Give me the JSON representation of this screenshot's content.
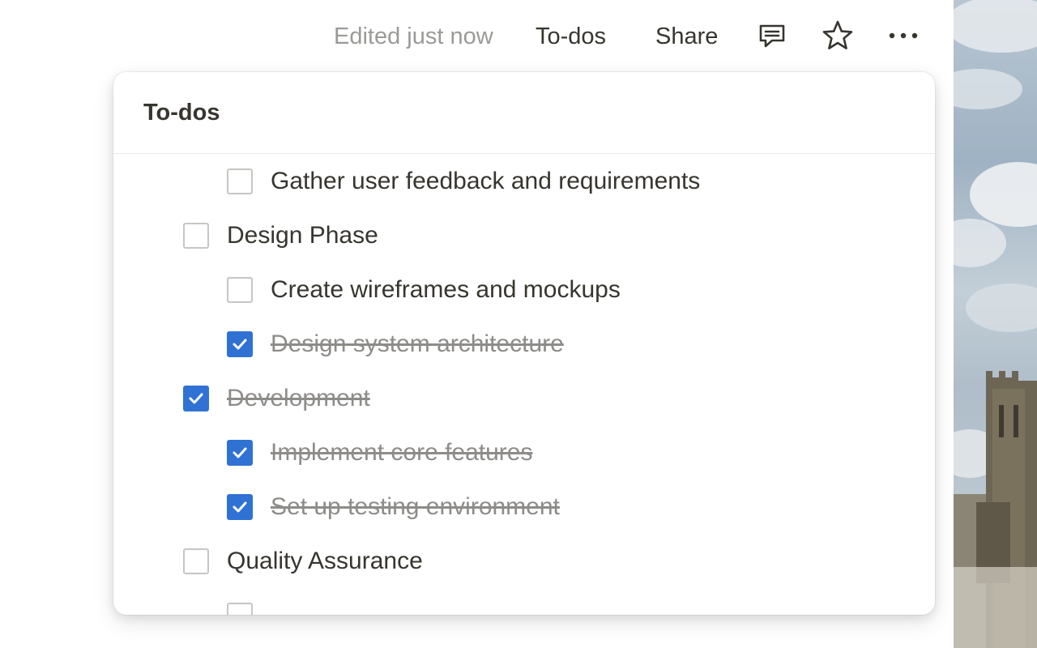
{
  "topbar": {
    "edited_status": "Edited just now",
    "todos_label": "To-dos",
    "share_label": "Share",
    "comment_icon": "comment-icon",
    "favorite_icon": "star-icon",
    "more_icon": "more-horizontal-icon"
  },
  "panel": {
    "title": "To-dos",
    "items": [
      {
        "label": "Gather user feedback and requirements",
        "checked": false,
        "level": 2
      },
      {
        "label": "Design Phase",
        "checked": false,
        "level": 1
      },
      {
        "label": "Create wireframes and mockups",
        "checked": false,
        "level": 2
      },
      {
        "label": "Design system architecture",
        "checked": true,
        "level": 2
      },
      {
        "label": "Development",
        "checked": true,
        "level": 1
      },
      {
        "label": "Implement core features",
        "checked": true,
        "level": 2
      },
      {
        "label": "Set up testing environment",
        "checked": true,
        "level": 2
      },
      {
        "label": "Quality Assurance",
        "checked": false,
        "level": 1
      },
      {
        "label": "",
        "checked": false,
        "level": 2
      }
    ]
  },
  "colors": {
    "checkbox_checked": "#2f72d4",
    "text_primary": "#37352f",
    "text_muted": "#9b9a97"
  }
}
